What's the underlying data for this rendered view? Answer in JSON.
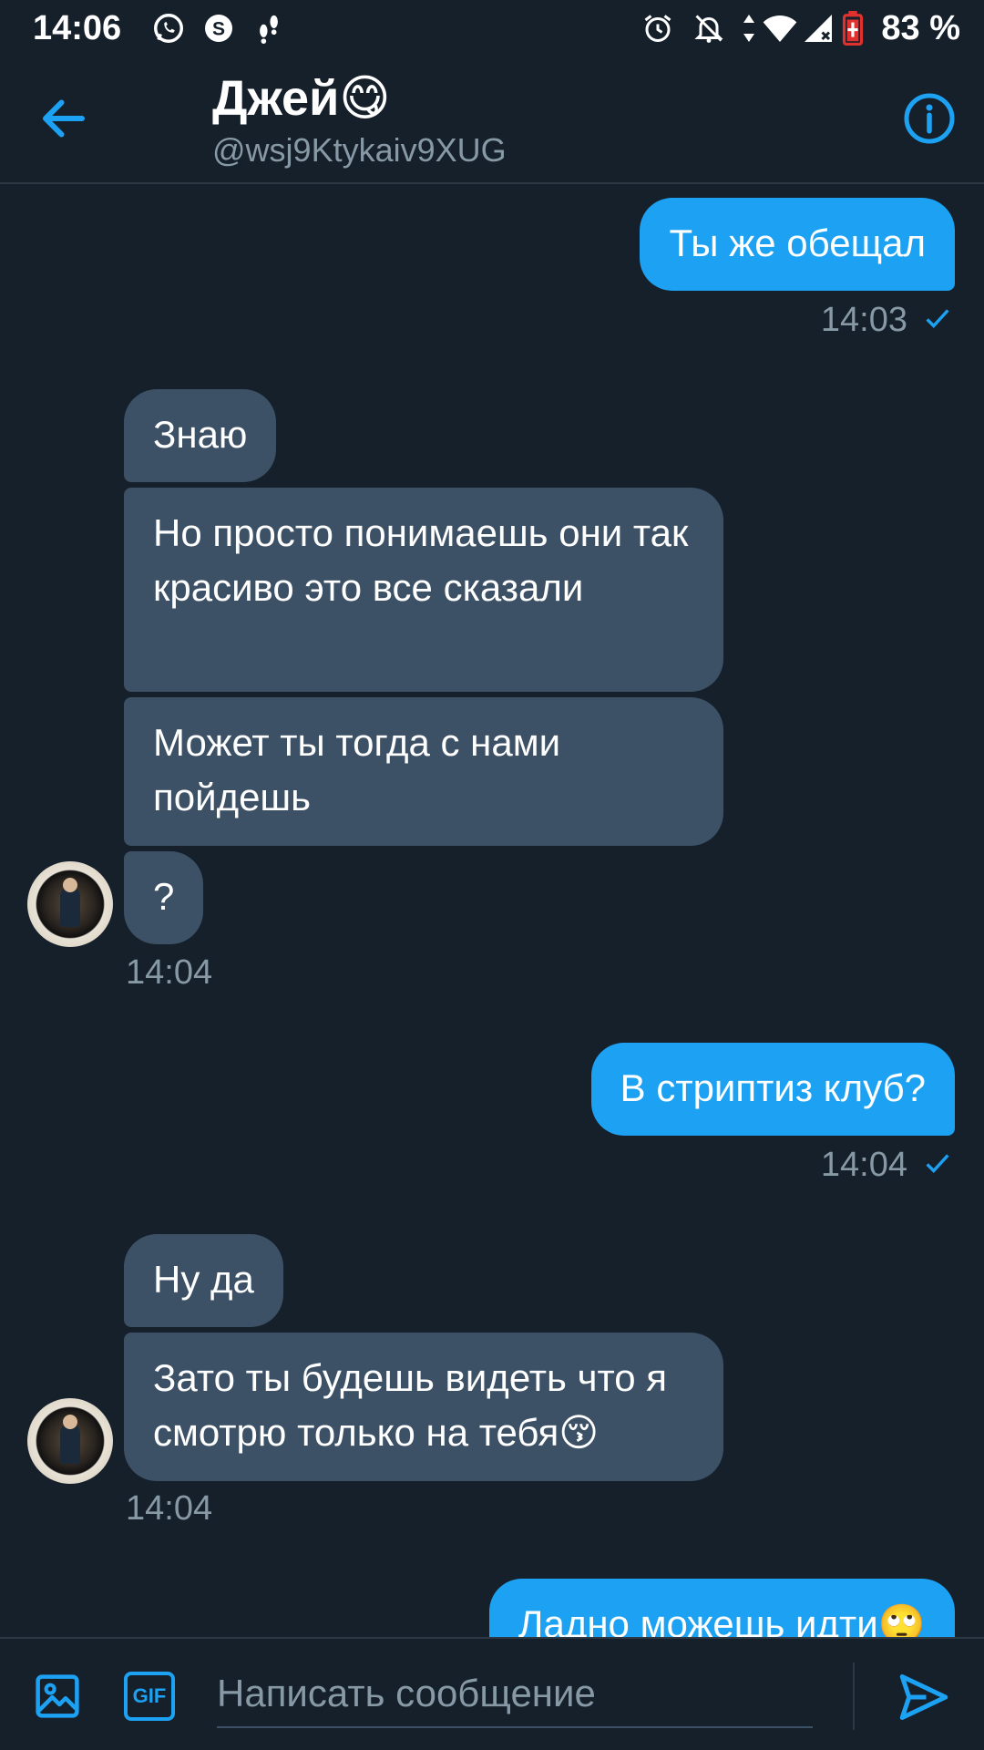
{
  "status_bar": {
    "time": "14:06",
    "battery": "83 %"
  },
  "header": {
    "name": "Джей",
    "name_emoji": "😋",
    "handle": "@wsj9Ktykaiv9XUG"
  },
  "messages": [
    {
      "dir": "out",
      "text": "Ты же обещал",
      "time": "14:03"
    },
    {
      "dir": "in",
      "text": "Знаю"
    },
    {
      "dir": "in",
      "text": "Но просто понимаешь они так красиво это все сказали"
    },
    {
      "dir": "in",
      "text": "Может ты тогда с нами пойдешь"
    },
    {
      "dir": "in",
      "text": "?",
      "time": "14:04"
    },
    {
      "dir": "out",
      "text": "В стриптиз клуб?",
      "time": "14:04"
    },
    {
      "dir": "in",
      "text": "Ну да"
    },
    {
      "dir": "in",
      "text": "Зато ты будешь видеть что я смотрю только на тебя😚",
      "time": "14:04"
    },
    {
      "dir": "out",
      "text": "Ладно можешь идти🙄"
    }
  ],
  "composer": {
    "gif_label": "GIF",
    "placeholder": "Написать сообщение"
  },
  "colors": {
    "background": "#15202b",
    "accent": "#1da1f2",
    "incoming_bubble": "#3d5166",
    "muted_text": "#8899a6"
  }
}
